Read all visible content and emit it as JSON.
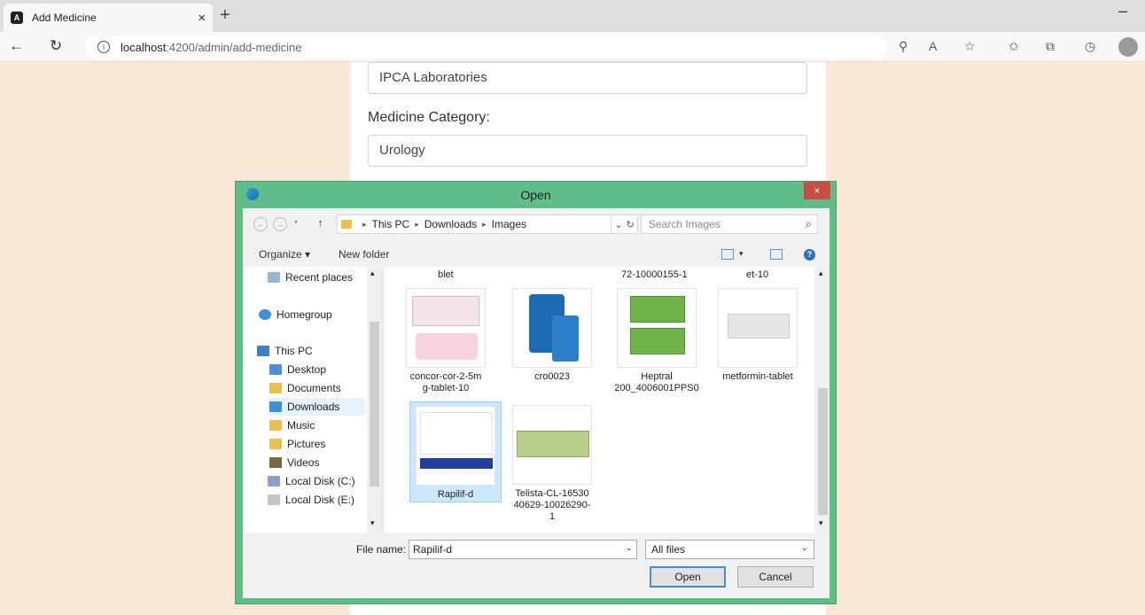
{
  "browser": {
    "tab_title": "Add Medicine",
    "tab_close": "×",
    "new_tab": "+",
    "minimize": "–",
    "url_host": "localhost",
    "url_path": ":4200/admin/add-medicine"
  },
  "form": {
    "manufacturer_value": "IPCA Laboratories",
    "category_label": "Medicine Category:",
    "category_value": "Urology"
  },
  "dialog": {
    "title": "Open",
    "close": "×",
    "breadcrumb": [
      "This PC",
      "Downloads",
      "Images"
    ],
    "search_placeholder": "Search Images",
    "organize_label": "Organize ▾",
    "new_folder_label": "New folder",
    "nav_items": [
      {
        "label": "Recent places",
        "icon": "recent-places-icon"
      },
      {
        "label": "Homegroup",
        "icon": "homegroup-icon"
      },
      {
        "label": "This PC",
        "icon": "computer-icon"
      },
      {
        "label": "Desktop",
        "icon": "desktop-folder-icon"
      },
      {
        "label": "Documents",
        "icon": "documents-folder-icon"
      },
      {
        "label": "Downloads",
        "icon": "downloads-folder-icon"
      },
      {
        "label": "Music",
        "icon": "music-folder-icon"
      },
      {
        "label": "Pictures",
        "icon": "pictures-folder-icon"
      },
      {
        "label": "Videos",
        "icon": "videos-folder-icon"
      },
      {
        "label": "Local Disk (C:)",
        "icon": "drive-icon"
      },
      {
        "label": "Local Disk (E:)",
        "icon": "drive-icon"
      }
    ],
    "partial_labels": [
      "blet",
      "72-10000155-1",
      "et-10"
    ],
    "files": [
      {
        "name": "concor-cor-2-5mg-tablet-10",
        "line1": "concor-cor-2-5m",
        "line2": "g-tablet-10",
        "line3": ""
      },
      {
        "name": "cro0023",
        "line1": "cro0023",
        "line2": "",
        "line3": ""
      },
      {
        "name": "Heptral 200_4006001PPS0",
        "line1": "Heptral",
        "line2": "200_4006001PPS0",
        "line3": ""
      },
      {
        "name": "metformin-tablet",
        "line1": "metformin-tablet",
        "line2": "",
        "line3": ""
      },
      {
        "name": "Rapilif-d",
        "line1": "Rapilif-d",
        "line2": "",
        "line3": ""
      },
      {
        "name": "Telista-CL-1653040629-10026290-1",
        "line1": "Telista-CL-16530",
        "line2": "40629-10026290-",
        "line3": "1"
      }
    ],
    "file_name_label": "File name:",
    "file_name_value": "Rapilif-d",
    "file_type_value": "All files",
    "open_button": "Open",
    "cancel_button": "Cancel"
  },
  "colors": {
    "page_bg": "#fae8d6",
    "dialog_frame": "#5fbd8a",
    "close_red": "#c94c45",
    "selection": "#cce8ff"
  }
}
